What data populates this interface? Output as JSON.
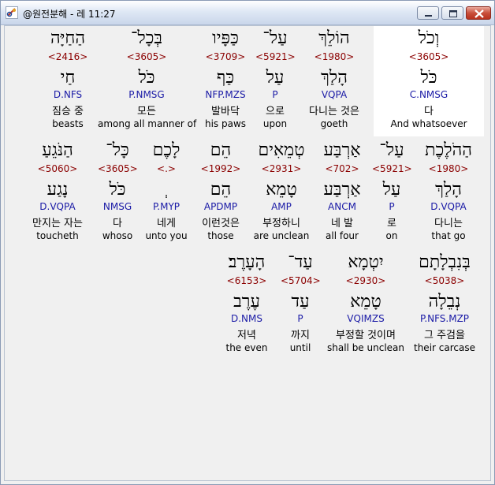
{
  "window": {
    "title": "@원전분해 - 레 11:27"
  },
  "rows": [
    {
      "words": [
        {
          "heb": "הַחַיָּה",
          "num": "<2416>",
          "lemma": "חַי",
          "morph": "D.NFS",
          "kor": "짐승 중",
          "eng": "beasts"
        },
        {
          "heb": "בְּכָל־",
          "num": "<3605>",
          "lemma": "כֹּל",
          "morph": "P.NMSG",
          "kor": "모든",
          "eng": "among all manner of"
        },
        {
          "heb": "כַּפָּיו",
          "num": "<3709>",
          "lemma": "כַּף",
          "morph": "NFP.MZS",
          "kor": "발바닥",
          "eng": "his paws"
        },
        {
          "heb": "עַל־",
          "num": "<5921>",
          "lemma": "עַל",
          "morph": "P",
          "kor": "으로",
          "eng": "upon"
        },
        {
          "heb": "הוֹלֵךְ",
          "num": "<1980>",
          "lemma": "הָלַךְ",
          "morph": "VQPA",
          "kor": "다니는 것은",
          "eng": "goeth"
        },
        {
          "heb": "וְכֹל",
          "num": "<3605>",
          "lemma": "כֹּל",
          "morph": "C.NMSG",
          "kor": "다",
          "eng": "And whatsoever"
        }
      ]
    },
    {
      "words": [
        {
          "heb": "הַנֹּגֵעַ",
          "num": "<5060>",
          "lemma": "נָגַע",
          "morph": "D.VQPA",
          "kor": "만지는 자는",
          "eng": "toucheth"
        },
        {
          "heb": "כָּל־",
          "num": "<3605>",
          "lemma": "כֹּל",
          "morph": "NMSG",
          "kor": "다",
          "eng": "whoso"
        },
        {
          "heb": "לָכֶם",
          "num": "<.>",
          "lemma": "ְ",
          "morph": "P.MYP",
          "kor": "네게",
          "eng": "unto you"
        },
        {
          "heb": "הֵם",
          "num": "<1992>",
          "lemma": "הֵם",
          "morph": "APDMP",
          "kor": "이런것은",
          "eng": "those"
        },
        {
          "heb": "טְמֵאִים",
          "num": "<2931>",
          "lemma": "טָמֵא",
          "morph": "AMP",
          "kor": "부정하니",
          "eng": "are unclean"
        },
        {
          "heb": "אַרְבַּע",
          "num": "<702>",
          "lemma": "אַרְבַּע",
          "morph": "ANCM",
          "kor": "네 발",
          "eng": "all four"
        },
        {
          "heb": "עַל־",
          "num": "<5921>",
          "lemma": "עַל",
          "morph": "P",
          "kor": "로",
          "eng": "on"
        },
        {
          "heb": "הַהֹלֶכֶת",
          "num": "<1980>",
          "lemma": "הָלַךְ",
          "morph": "D.VQPA",
          "kor": "다니는",
          "eng": "that go"
        }
      ]
    },
    {
      "words": [
        {
          "heb": "הָעָרֶב׃",
          "num": "<6153>",
          "lemma": "עֶרֶב",
          "morph": "D.NMS",
          "kor": "저녁",
          "eng": "the even"
        },
        {
          "heb": "עַד־",
          "num": "<5704>",
          "lemma": "עַד",
          "morph": "P",
          "kor": "까지",
          "eng": "until"
        },
        {
          "heb": "יִטְמָא",
          "num": "<2930>",
          "lemma": "טָמֵא",
          "morph": "VQIMZS",
          "kor": "부정할 것이며",
          "eng": "shall be unclean"
        },
        {
          "heb": "בְּנִבְלָתָם",
          "num": "<5038>",
          "lemma": "נְבֵלָה",
          "morph": "P.NFS.MZP",
          "kor": "그 주검을",
          "eng": "their carcase"
        }
      ]
    }
  ]
}
